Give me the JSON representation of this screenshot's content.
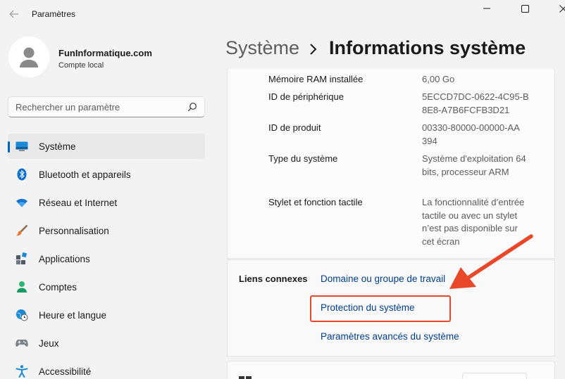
{
  "window": {
    "title": "Paramètres"
  },
  "profile": {
    "name": "FunInformatique.com",
    "account_type": "Compte local"
  },
  "search": {
    "placeholder": "Rechercher un paramètre"
  },
  "nav": {
    "items": [
      {
        "label": "Système",
        "icon": "system-icon",
        "active": true
      },
      {
        "label": "Bluetooth et appareils",
        "icon": "bluetooth-icon"
      },
      {
        "label": "Réseau et Internet",
        "icon": "wifi-icon"
      },
      {
        "label": "Personnalisation",
        "icon": "paintbrush-icon"
      },
      {
        "label": "Applications",
        "icon": "apps-icon"
      },
      {
        "label": "Comptes",
        "icon": "accounts-icon"
      },
      {
        "label": "Heure et langue",
        "icon": "clock-globe-icon"
      },
      {
        "label": "Jeux",
        "icon": "gamepad-icon"
      },
      {
        "label": "Accessibilité",
        "icon": "accessibility-icon"
      }
    ]
  },
  "breadcrumb": {
    "parent": "Système",
    "current": "Informations système"
  },
  "specs": [
    {
      "label": "Mémoire RAM installée",
      "value": "6,00 Go"
    },
    {
      "label": "ID de périphérique",
      "value": "5ECCD7DC-0622-4C95-B8E8-A7B6FCFB3D21"
    },
    {
      "label": "ID de produit",
      "value": "00330-80000-00000-AA394"
    },
    {
      "label": "Type du système",
      "value": "Système d'exploitation 64 bits, processeur ARM"
    },
    {
      "label": "Stylet et fonction tactile",
      "value": "La fonctionnalité d’entrée tactile ou avec un stylet n’est pas disponible sur cet écran"
    }
  ],
  "related_links": {
    "title": "Liens connexes",
    "links": [
      "Domaine ou groupe de travail",
      "Protection du système",
      "Paramètres avancés du système"
    ]
  },
  "colors": {
    "accent": "#0067c0",
    "link": "#003e92",
    "annotation": "#e8472a"
  }
}
